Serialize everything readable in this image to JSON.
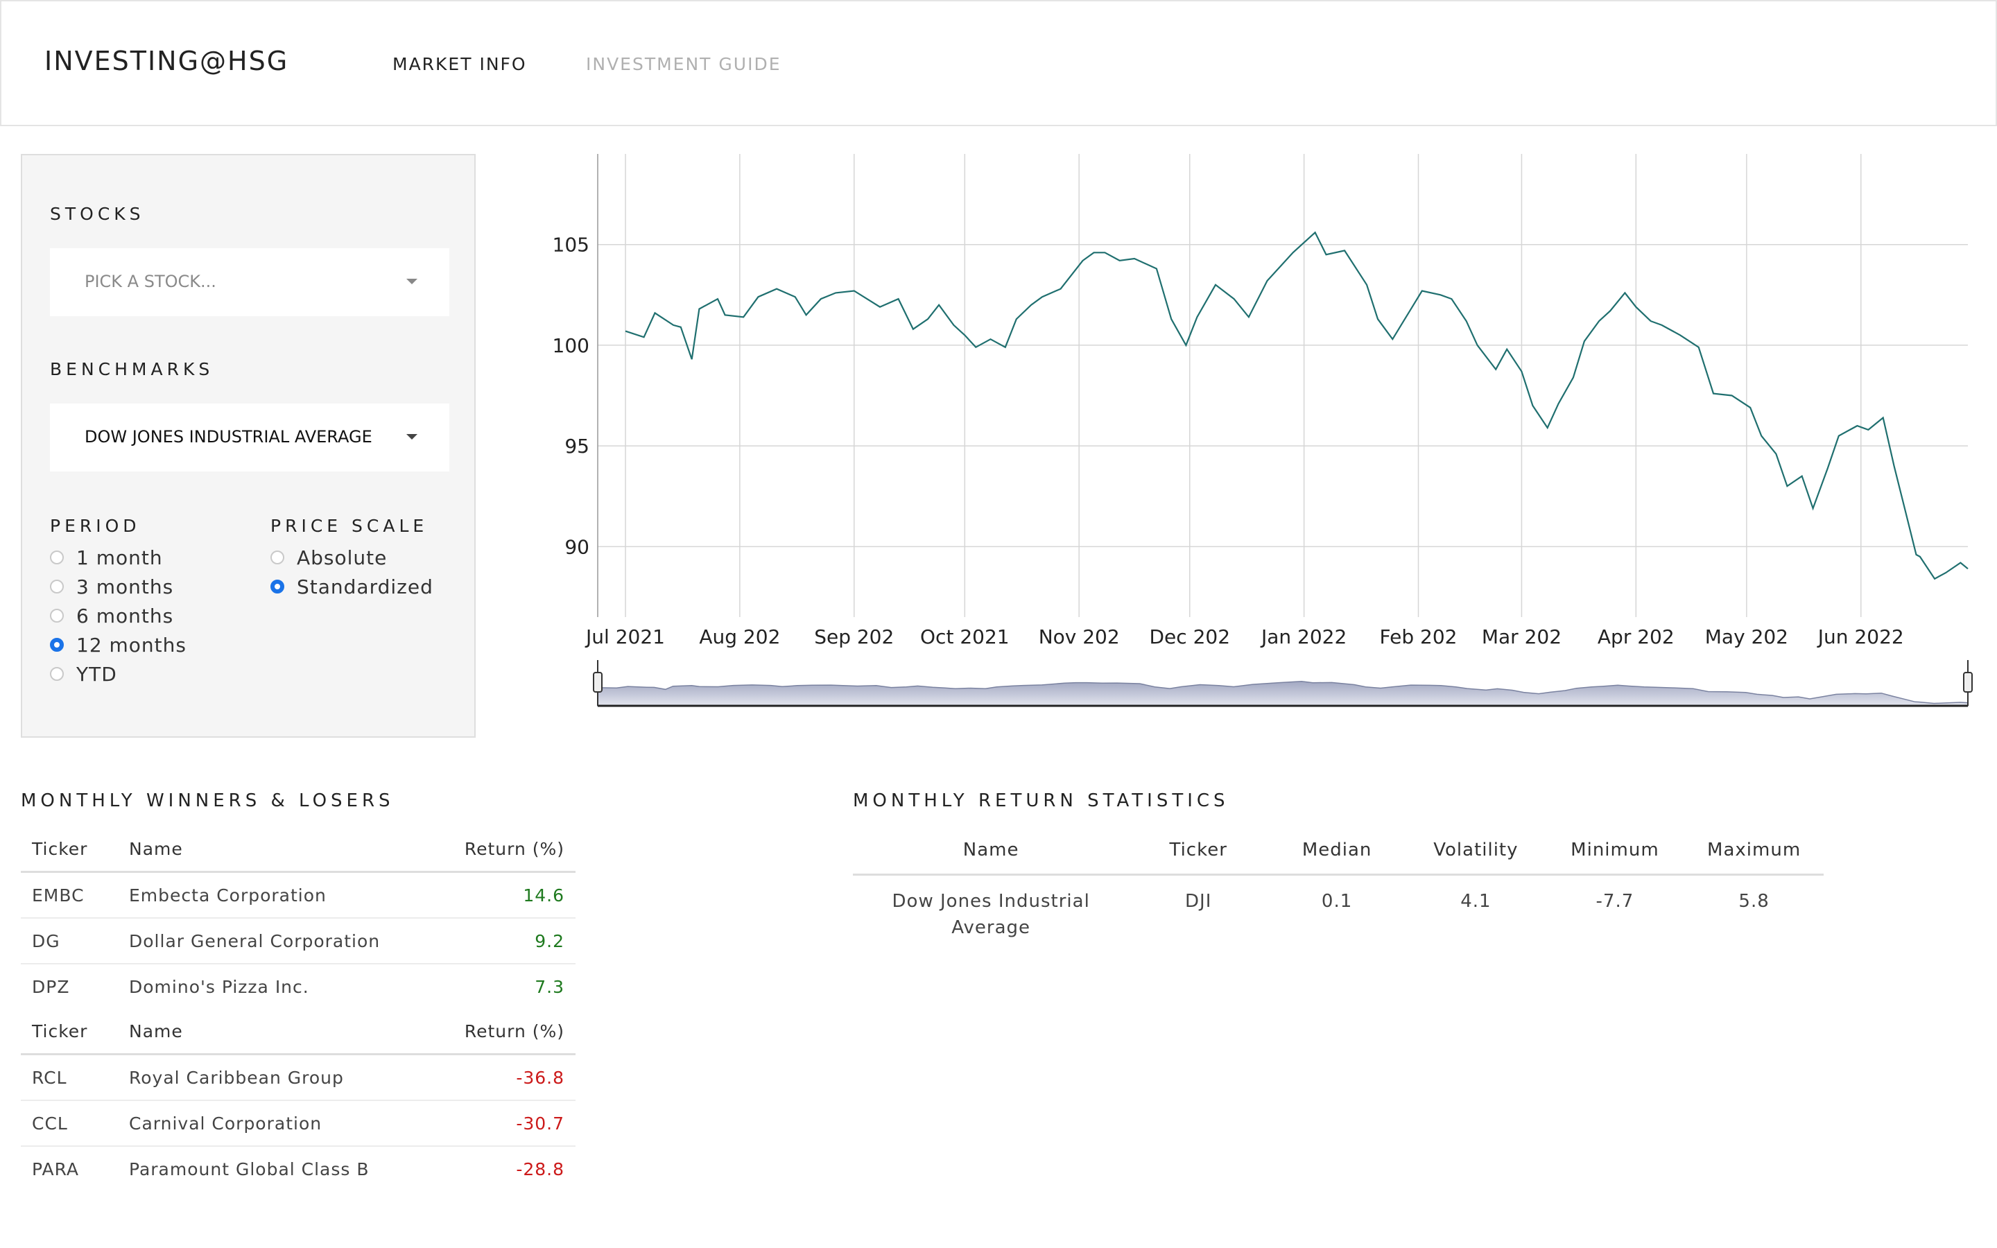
{
  "header": {
    "brand": "INVESTING@HSG",
    "nav": [
      {
        "label": "MARKET INFO",
        "active": true
      },
      {
        "label": "INVESTMENT GUIDE",
        "active": false
      }
    ]
  },
  "controls": {
    "stocks_label": "STOCKS",
    "stocks_placeholder": "PICK A STOCK...",
    "benchmarks_label": "BENCHMARKS",
    "benchmark_value": "DOW JONES INDUSTRIAL AVERAGE",
    "period_label": "PERIOD",
    "period_options": [
      "1 month",
      "3 months",
      "6 months",
      "12 months",
      "YTD"
    ],
    "period_selected": "12 months",
    "scale_label": "PRICE SCALE",
    "scale_options": [
      "Absolute",
      "Standardized"
    ],
    "scale_selected": "Standardized"
  },
  "chart_data": {
    "type": "line",
    "title": "",
    "xlabel": "",
    "ylabel": "",
    "x_ticks": [
      "Jul 2021",
      "Aug 202",
      "Sep 202",
      "Oct 2021",
      "Nov 202",
      "Dec 202",
      "Jan 2022",
      "Feb 202",
      "Mar 202",
      "Apr 202",
      "May 202",
      "Jun 2022"
    ],
    "y_ticks": [
      90,
      95,
      100,
      105
    ],
    "ylim": [
      86.5,
      109.5
    ],
    "x_range": [
      "2021-07-01",
      "2022-06-30"
    ],
    "grid": true,
    "line_color": "#1f6f6f",
    "range_slider": true,
    "series": [
      {
        "name": "",
        "points": [
          [
            "2021-07-01",
            100.7
          ],
          [
            "2021-07-06",
            100.4
          ],
          [
            "2021-07-09",
            101.6
          ],
          [
            "2021-07-14",
            101.0
          ],
          [
            "2021-07-16",
            100.9
          ],
          [
            "2021-07-19",
            99.3
          ],
          [
            "2021-07-21",
            101.8
          ],
          [
            "2021-07-26",
            102.3
          ],
          [
            "2021-07-28",
            101.5
          ],
          [
            "2021-08-02",
            101.4
          ],
          [
            "2021-08-06",
            102.4
          ],
          [
            "2021-08-11",
            102.8
          ],
          [
            "2021-08-16",
            102.4
          ],
          [
            "2021-08-19",
            101.5
          ],
          [
            "2021-08-23",
            102.3
          ],
          [
            "2021-08-27",
            102.6
          ],
          [
            "2021-09-01",
            102.7
          ],
          [
            "2021-09-08",
            101.9
          ],
          [
            "2021-09-13",
            102.3
          ],
          [
            "2021-09-17",
            100.8
          ],
          [
            "2021-09-21",
            101.3
          ],
          [
            "2021-09-24",
            102.0
          ],
          [
            "2021-09-28",
            101.0
          ],
          [
            "2021-10-01",
            100.5
          ],
          [
            "2021-10-04",
            99.9
          ],
          [
            "2021-10-08",
            100.3
          ],
          [
            "2021-10-12",
            99.9
          ],
          [
            "2021-10-15",
            101.3
          ],
          [
            "2021-10-19",
            102.0
          ],
          [
            "2021-10-22",
            102.4
          ],
          [
            "2021-10-27",
            102.8
          ],
          [
            "2021-11-02",
            104.2
          ],
          [
            "2021-11-05",
            104.6
          ],
          [
            "2021-11-08",
            104.6
          ],
          [
            "2021-11-12",
            104.2
          ],
          [
            "2021-11-16",
            104.3
          ],
          [
            "2021-11-22",
            103.8
          ],
          [
            "2021-11-26",
            101.3
          ],
          [
            "2021-11-30",
            100.0
          ],
          [
            "2021-12-03",
            101.4
          ],
          [
            "2021-12-08",
            103.0
          ],
          [
            "2021-12-13",
            102.3
          ],
          [
            "2021-12-17",
            101.4
          ],
          [
            "2021-12-22",
            103.2
          ],
          [
            "2021-12-29",
            104.6
          ],
          [
            "2022-01-04",
            105.6
          ],
          [
            "2022-01-07",
            104.5
          ],
          [
            "2022-01-12",
            104.7
          ],
          [
            "2022-01-18",
            103.0
          ],
          [
            "2022-01-21",
            101.3
          ],
          [
            "2022-01-25",
            100.3
          ],
          [
            "2022-01-28",
            101.2
          ],
          [
            "2022-02-02",
            102.7
          ],
          [
            "2022-02-07",
            102.5
          ],
          [
            "2022-02-10",
            102.3
          ],
          [
            "2022-02-14",
            101.2
          ],
          [
            "2022-02-17",
            100.0
          ],
          [
            "2022-02-22",
            98.8
          ],
          [
            "2022-02-25",
            99.8
          ],
          [
            "2022-03-01",
            98.7
          ],
          [
            "2022-03-04",
            97.0
          ],
          [
            "2022-03-08",
            95.9
          ],
          [
            "2022-03-11",
            97.1
          ],
          [
            "2022-03-15",
            98.4
          ],
          [
            "2022-03-18",
            100.2
          ],
          [
            "2022-03-22",
            101.2
          ],
          [
            "2022-03-25",
            101.7
          ],
          [
            "2022-03-29",
            102.6
          ],
          [
            "2022-04-01",
            101.9
          ],
          [
            "2022-04-05",
            101.2
          ],
          [
            "2022-04-08",
            101.0
          ],
          [
            "2022-04-13",
            100.5
          ],
          [
            "2022-04-18",
            99.9
          ],
          [
            "2022-04-22",
            97.6
          ],
          [
            "2022-04-27",
            97.5
          ],
          [
            "2022-05-02",
            96.9
          ],
          [
            "2022-05-05",
            95.5
          ],
          [
            "2022-05-09",
            94.6
          ],
          [
            "2022-05-12",
            93.0
          ],
          [
            "2022-05-16",
            93.5
          ],
          [
            "2022-05-19",
            91.9
          ],
          [
            "2022-05-23",
            93.9
          ],
          [
            "2022-05-26",
            95.5
          ],
          [
            "2022-05-31",
            96.0
          ],
          [
            "2022-06-03",
            95.8
          ],
          [
            "2022-06-07",
            96.4
          ],
          [
            "2022-06-10",
            94.0
          ],
          [
            "2022-06-13",
            91.8
          ],
          [
            "2022-06-16",
            89.6
          ],
          [
            "2022-06-17",
            89.5
          ],
          [
            "2022-06-21",
            88.4
          ],
          [
            "2022-06-24",
            88.7
          ],
          [
            "2022-06-28",
            89.2
          ],
          [
            "2022-06-30",
            88.9
          ]
        ]
      }
    ]
  },
  "winners_losers": {
    "title": "MONTHLY WINNERS & LOSERS",
    "headers": [
      "Ticker",
      "Name",
      "Return (%)"
    ],
    "winners": [
      {
        "ticker": "EMBC",
        "name": "Embecta Corporation",
        "return": "14.6"
      },
      {
        "ticker": "DG",
        "name": "Dollar General Corporation",
        "return": "9.2"
      },
      {
        "ticker": "DPZ",
        "name": "Domino's Pizza Inc.",
        "return": "7.3"
      }
    ],
    "losers": [
      {
        "ticker": "RCL",
        "name": "Royal Caribbean Group",
        "return": "-36.8"
      },
      {
        "ticker": "CCL",
        "name": "Carnival Corporation",
        "return": "-30.7"
      },
      {
        "ticker": "PARA",
        "name": "Paramount Global Class B",
        "return": "-28.8"
      }
    ],
    "colors": {
      "positive": "#1f7a1f",
      "negative": "#cc1a1a"
    }
  },
  "statistics": {
    "title": "MONTHLY RETURN STATISTICS",
    "headers": [
      "Name",
      "Ticker",
      "Median",
      "Volatility",
      "Minimum",
      "Maximum"
    ],
    "rows": [
      {
        "name": "Dow Jones Industrial Average",
        "ticker": "DJI",
        "median": "0.1",
        "volatility": "4.1",
        "minimum": "-7.7",
        "maximum": "5.8"
      }
    ]
  }
}
